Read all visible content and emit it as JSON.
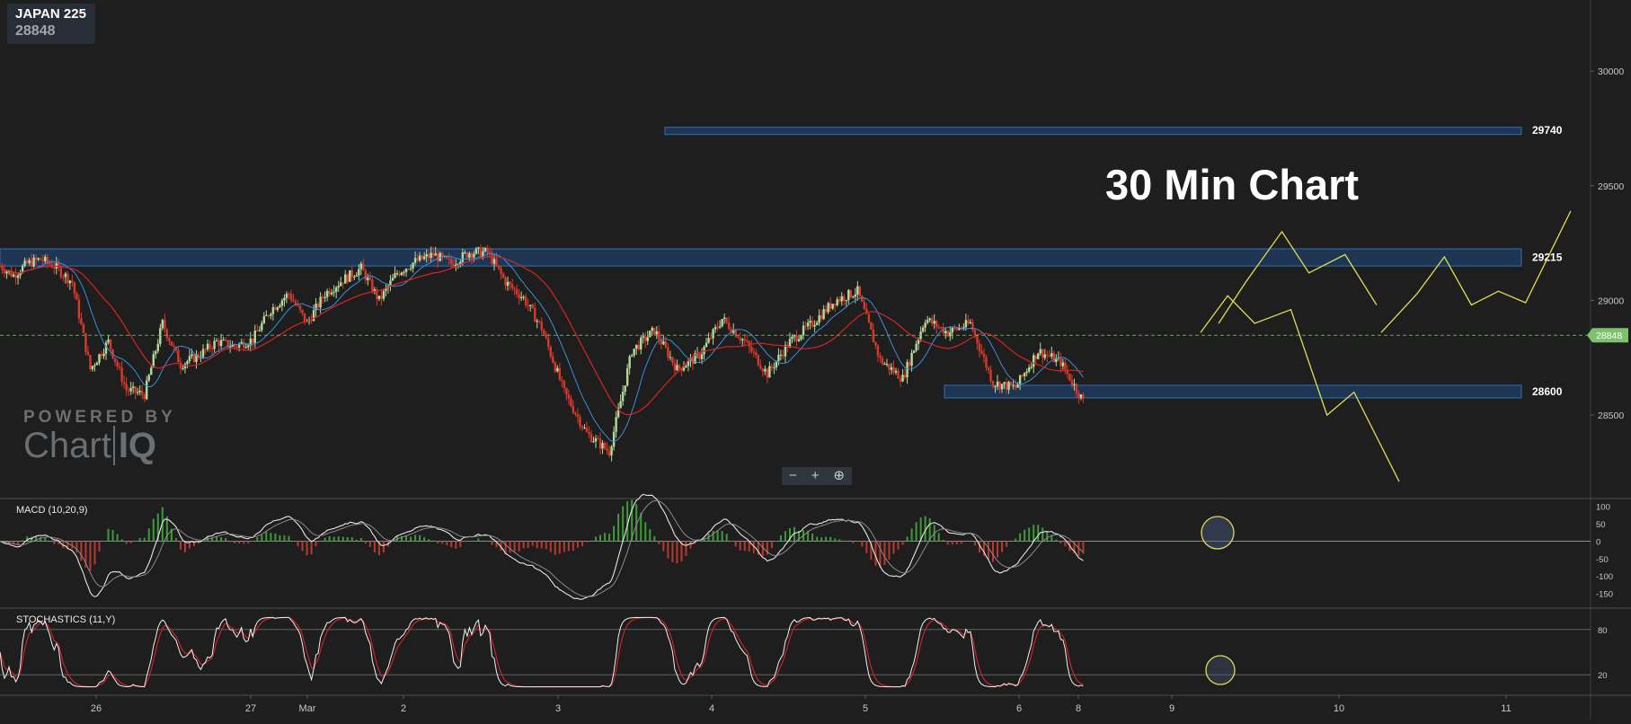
{
  "symbol": {
    "name": "JAPAN 225",
    "price": "28848"
  },
  "annotation_title": "30 Min Chart",
  "watermark": {
    "line1": "POWERED BY",
    "line2a": "Chart",
    "line2b": "IQ"
  },
  "zoom": {
    "minus": "−",
    "plus": "+",
    "magnify": "⊕"
  },
  "colors": {
    "background": "#1e1e1e",
    "candle_up": "#b5d99c",
    "candle_down": "#d9392b",
    "ma_fast": "#3a8fd9",
    "ma_slow": "#d62424",
    "zone_fill": "#1f3f66",
    "zone_stroke": "#2e6fb5",
    "projection": "#e0dc55",
    "price_tag": "#7cc26e"
  },
  "chart_data": [
    {
      "type": "candlestick",
      "panel": "price",
      "x_labels": [
        "26",
        "27",
        "Mar",
        "2",
        "3",
        "4",
        "5",
        "6",
        "8",
        "9",
        "10",
        "11"
      ],
      "y_ticks": [
        30000,
        29500,
        29000,
        28500
      ],
      "ylim": [
        28140,
        30310
      ],
      "current_price": 28848,
      "overlays": [
        "fast moving average (blue)",
        "slow moving average (red)"
      ],
      "key_levels": [
        {
          "label": "29740",
          "low": 29730,
          "high": 29755
        },
        {
          "label": "29215",
          "low": 29150,
          "high": 29225
        },
        {
          "label": "28600",
          "low": 28575,
          "high": 28630
        }
      ],
      "close_path": [
        {
          "t": 0,
          "c": 29150
        },
        {
          "t": 3,
          "c": 29110
        },
        {
          "t": 6,
          "c": 29160
        },
        {
          "t": 9,
          "c": 29180
        },
        {
          "t": 12,
          "c": 29150
        },
        {
          "t": 16,
          "c": 29080
        },
        {
          "t": 20,
          "c": 28700
        },
        {
          "t": 24,
          "c": 28820
        },
        {
          "t": 28,
          "c": 28610
        },
        {
          "t": 32,
          "c": 28590
        },
        {
          "t": 36,
          "c": 28900
        },
        {
          "t": 40,
          "c": 28720
        },
        {
          "t": 44,
          "c": 28760
        },
        {
          "t": 48,
          "c": 28820
        },
        {
          "t": 52,
          "c": 28800
        },
        {
          "t": 56,
          "c": 28830
        },
        {
          "t": 60,
          "c": 28960
        },
        {
          "t": 64,
          "c": 29030
        },
        {
          "t": 68,
          "c": 28900
        },
        {
          "t": 72,
          "c": 29030
        },
        {
          "t": 76,
          "c": 29090
        },
        {
          "t": 80,
          "c": 29140
        },
        {
          "t": 84,
          "c": 29000
        },
        {
          "t": 88,
          "c": 29120
        },
        {
          "t": 92,
          "c": 29170
        },
        {
          "t": 96,
          "c": 29200
        },
        {
          "t": 100,
          "c": 29160
        },
        {
          "t": 104,
          "c": 29210
        },
        {
          "t": 108,
          "c": 29210
        },
        {
          "t": 112,
          "c": 29080
        },
        {
          "t": 116,
          "c": 29010
        },
        {
          "t": 120,
          "c": 28880
        },
        {
          "t": 125,
          "c": 28600
        },
        {
          "t": 130,
          "c": 28420
        },
        {
          "t": 135,
          "c": 28340
        },
        {
          "t": 140,
          "c": 28780
        },
        {
          "t": 145,
          "c": 28870
        },
        {
          "t": 150,
          "c": 28700
        },
        {
          "t": 155,
          "c": 28760
        },
        {
          "t": 160,
          "c": 28920
        },
        {
          "t": 165,
          "c": 28820
        },
        {
          "t": 170,
          "c": 28680
        },
        {
          "t": 175,
          "c": 28820
        },
        {
          "t": 180,
          "c": 28900
        },
        {
          "t": 185,
          "c": 29000
        },
        {
          "t": 190,
          "c": 29040
        },
        {
          "t": 195,
          "c": 28740
        },
        {
          "t": 200,
          "c": 28660
        },
        {
          "t": 205,
          "c": 28920
        },
        {
          "t": 210,
          "c": 28860
        },
        {
          "t": 215,
          "c": 28900
        },
        {
          "t": 220,
          "c": 28640
        },
        {
          "t": 225,
          "c": 28620
        },
        {
          "t": 230,
          "c": 28780
        },
        {
          "t": 235,
          "c": 28730
        },
        {
          "t": 240,
          "c": 28560
        }
      ],
      "projections": [
        [
          {
            "t": 270,
            "c": 28900
          },
          {
            "t": 276,
            "c": 29080
          },
          {
            "t": 284,
            "c": 29300
          },
          {
            "t": 290,
            "c": 29120
          },
          {
            "t": 298,
            "c": 29200
          },
          {
            "t": 305,
            "c": 28980
          }
        ],
        [
          {
            "t": 266,
            "c": 28860
          },
          {
            "t": 272,
            "c": 29020
          },
          {
            "t": 278,
            "c": 28900
          },
          {
            "t": 286,
            "c": 28960
          },
          {
            "t": 294,
            "c": 28500
          },
          {
            "t": 300,
            "c": 28600
          },
          {
            "t": 310,
            "c": 28210
          }
        ],
        [
          {
            "t": 306,
            "c": 28860
          },
          {
            "t": 314,
            "c": 29030
          },
          {
            "t": 320,
            "c": 29190
          },
          {
            "t": 326,
            "c": 28980
          },
          {
            "t": 332,
            "c": 29040
          },
          {
            "t": 338,
            "c": 28990
          },
          {
            "t": 348,
            "c": 29390
          }
        ]
      ]
    },
    {
      "type": "line",
      "panel": "indicator",
      "title": "MACD (10,20,9)",
      "y_ticks": [
        100,
        50,
        0,
        -50,
        -100,
        -150
      ],
      "ylim": [
        -190,
        120
      ],
      "series": [
        {},
        {},
        {}
      ]
    },
    {
      "type": "line",
      "panel": "indicator",
      "title": "STOCHASTICS (11,Y)",
      "y_ticks": [
        80,
        20
      ],
      "ylim": [
        0,
        100
      ],
      "series": [
        {},
        {}
      ]
    }
  ]
}
